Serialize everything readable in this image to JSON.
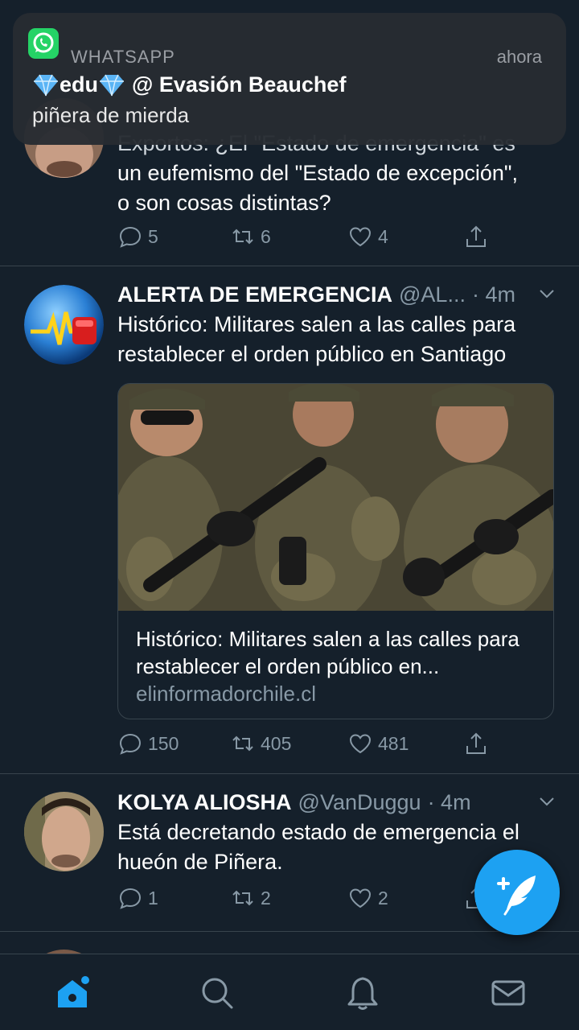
{
  "notification": {
    "app": "WHATSAPP",
    "time": "ahora",
    "sender": "edu",
    "group": "@ Evasión Beauchef",
    "message": "piñera de mierda"
  },
  "tweets": [
    {
      "text_line1": "un eufemismo del \"Estado de excepción\",",
      "text_line2": "o son cosas distintas?",
      "replies": "5",
      "retweets": "6",
      "likes": "4"
    },
    {
      "name": "ALERTA DE EMERGENCIA",
      "handle": "@AL...",
      "time": "· 4m",
      "text": "Histórico: Militares salen a las calles para restablecer el orden público en Santiago",
      "card": {
        "title": "Histórico: Militares salen a las calles para restablecer el orden público en...",
        "domain": "elinformadorchile.cl"
      },
      "replies": "150",
      "retweets": "405",
      "likes": "481"
    },
    {
      "name": "KOLYA ALIOSHA",
      "handle": "@VanDuggu",
      "time": "· 4m",
      "text": "Está decretando estado de emergencia el hueón de Piñera.",
      "replies": "1",
      "retweets": "2",
      "likes": "2"
    }
  ],
  "colors": {
    "background": "#15202b",
    "accent": "#1da1f2",
    "secondary_text": "#8899a6",
    "divider": "#38444d"
  },
  "icons": [
    "reply-icon",
    "retweet-icon",
    "like-icon",
    "share-icon",
    "home-icon",
    "search-icon",
    "notifications-icon",
    "messages-icon",
    "compose-icon",
    "whatsapp-icon"
  ]
}
